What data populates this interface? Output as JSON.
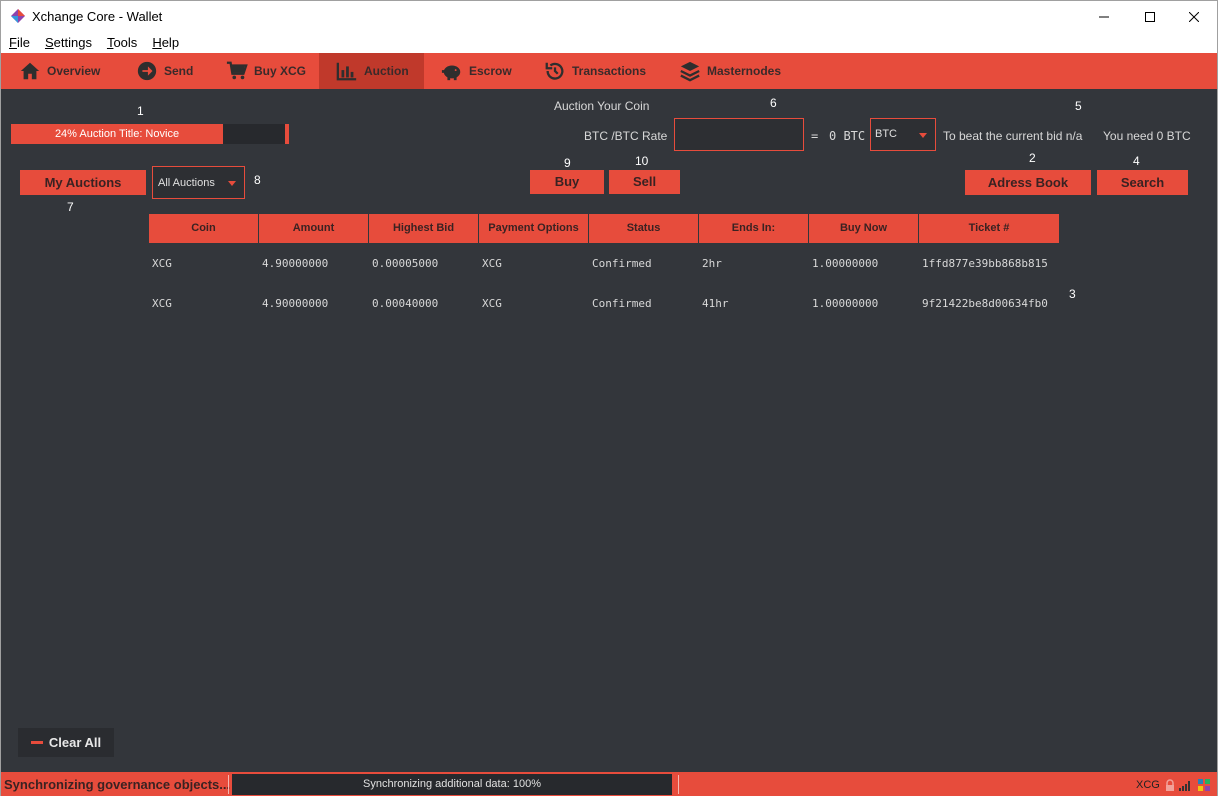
{
  "window": {
    "title": "Xchange Core - Wallet"
  },
  "menu": [
    {
      "label": "File",
      "u": "F",
      "rest": "ile"
    },
    {
      "label": "Settings",
      "u": "S",
      "rest": "ettings"
    },
    {
      "label": "Tools",
      "u": "T",
      "rest": "ools"
    },
    {
      "label": "Help",
      "u": "H",
      "rest": "elp"
    }
  ],
  "tabs": {
    "overview": "Overview",
    "send": "Send",
    "buy": "Buy XCG",
    "auction": "Auction",
    "escrow": "Escrow",
    "transactions": "Transactions",
    "masternodes": "Masternodes"
  },
  "annotations": {
    "n1": "1",
    "n2": "2",
    "n3": "3",
    "n4": "4",
    "n5": "5",
    "n6": "6",
    "n7": "7",
    "n8": "8",
    "n9": "9",
    "n10": "10"
  },
  "progress": {
    "text": "24% Auction Title: Novice",
    "percent": 24
  },
  "auction_form": {
    "heading": "Auction Your Coin",
    "rate_label": "BTC /BTC Rate",
    "equals": "=",
    "result": "0 BTC",
    "currency": "BTC",
    "beat_text": "To beat the current bid n/a",
    "need_text": "You need 0 BTC"
  },
  "buttons": {
    "my_auctions": "My Auctions",
    "filter": "All Auctions",
    "buy": "Buy",
    "sell": "Sell",
    "address_book": "Adress Book",
    "search": "Search",
    "clear_all": "Clear All"
  },
  "table": {
    "headers": [
      "Coin",
      "Amount",
      "Highest Bid",
      "Payment Options",
      "Status",
      "Ends In:",
      "Buy Now",
      "Ticket #"
    ],
    "rows": [
      [
        "XCG",
        "4.90000000",
        "0.00005000",
        "XCG",
        "Confirmed",
        "2hr",
        "1.00000000",
        "1ffd877e39bb868b815"
      ],
      [
        "XCG",
        "4.90000000",
        "0.00040000",
        "XCG",
        "Confirmed",
        "41hr",
        "1.00000000",
        "9f21422be8d00634fb0"
      ]
    ]
  },
  "status": {
    "sync_label": "Synchronizing governance objects...",
    "sync_progress": "Synchronizing additional data: 100%",
    "unit": "XCG"
  },
  "colors": {
    "accent": "#e74c3c",
    "accent_dark": "#c0392b",
    "background": "#33363b"
  }
}
